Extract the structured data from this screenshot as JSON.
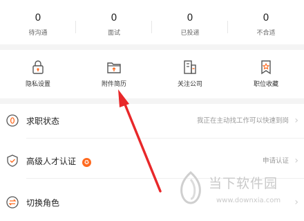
{
  "stats": [
    {
      "value": "0",
      "label": "待沟通"
    },
    {
      "value": "0",
      "label": "面试"
    },
    {
      "value": "0",
      "label": "已投递"
    },
    {
      "value": "0",
      "label": "不合适"
    }
  ],
  "shortcuts": [
    {
      "label": "隐私设置",
      "icon": "lock-icon"
    },
    {
      "label": "附件简历",
      "icon": "folder-icon"
    },
    {
      "label": "关注公司",
      "icon": "building-icon"
    },
    {
      "label": "职位收藏",
      "icon": "bookmark-star-icon"
    }
  ],
  "rows": [
    {
      "title": "求职状态",
      "right": "我正在主动找工作可以快速到岗",
      "icon": "status-icon"
    },
    {
      "title": "高级人才认证",
      "right": "申请认证",
      "icon": "shield-icon",
      "badge": "✪"
    },
    {
      "title": "切换角色",
      "right": "",
      "icon": "switch-icon"
    }
  ],
  "chevron": "›",
  "watermark": {
    "cn": "当下软件园",
    "url": "www.downxia.com"
  },
  "colors": {
    "accent": "#ff6a1f",
    "arrow": "#e8282a"
  }
}
